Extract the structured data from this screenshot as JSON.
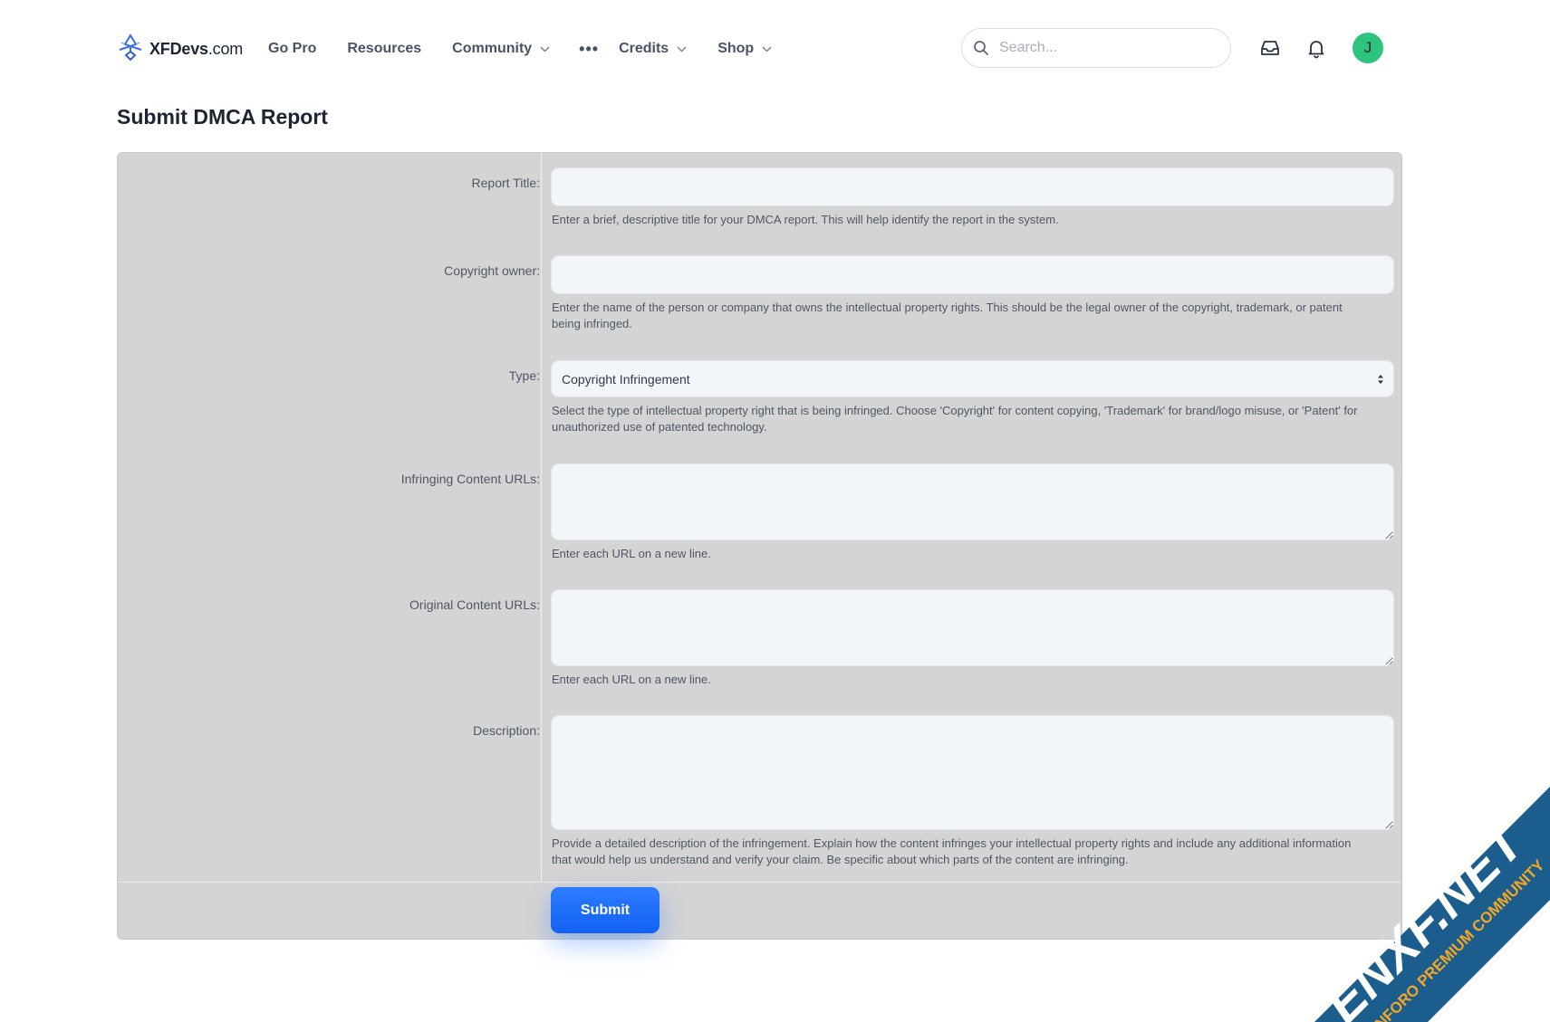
{
  "header": {
    "logo_text": "XFDevs",
    "logo_suffix": ".com",
    "nav": [
      {
        "label": "Go Pro"
      },
      {
        "label": "Resources"
      },
      {
        "label": "Community"
      },
      {
        "label": "Credits"
      },
      {
        "label": "Shop"
      }
    ],
    "more_label": "•••",
    "search_placeholder": "Search...",
    "avatar_letter": "J",
    "avatar_color": "#2ec47e"
  },
  "page": {
    "title": "Submit DMCA Report"
  },
  "form": {
    "report_title": {
      "label": "Report Title:",
      "value": "",
      "hint": "Enter a brief, descriptive title for your DMCA report. This will help identify the report in the system."
    },
    "copyright_owner": {
      "label": "Copyright owner:",
      "value": "",
      "hint": "Enter the name of the person or company that owns the intellectual property rights. This should be the legal owner of the copyright, trademark, or patent being infringed."
    },
    "type": {
      "label": "Type:",
      "selected": "Copyright Infringement",
      "hint": "Select the type of intellectual property right that is being infringed. Choose 'Copyright' for content copying, 'Trademark' for brand/logo misuse, or 'Patent' for unauthorized use of patented technology."
    },
    "infringing_urls": {
      "label": "Infringing Content URLs:",
      "value": "",
      "hint": "Enter each URL on a new line."
    },
    "original_urls": {
      "label": "Original Content URLs:",
      "value": "",
      "hint": "Enter each URL on a new line."
    },
    "description": {
      "label": "Description:",
      "value": "",
      "hint": "Provide a detailed description of the infringement. Explain how the content infringes your intellectual property rights and include any additional information that would help us understand and verify your claim. Be specific about which parts of the content are infringing."
    },
    "submit_label": "Submit"
  },
  "watermark": {
    "brand": "ENXF.NET",
    "tagline": "XENFORO PREMIUM COMMUNITY",
    "colors": {
      "band": "#1b5e8e",
      "text": "#f5a623"
    }
  },
  "colors": {
    "accent": "#1f6bff",
    "form_bg": "#d4d4d4",
    "field_bg": "#f3f6f9"
  }
}
